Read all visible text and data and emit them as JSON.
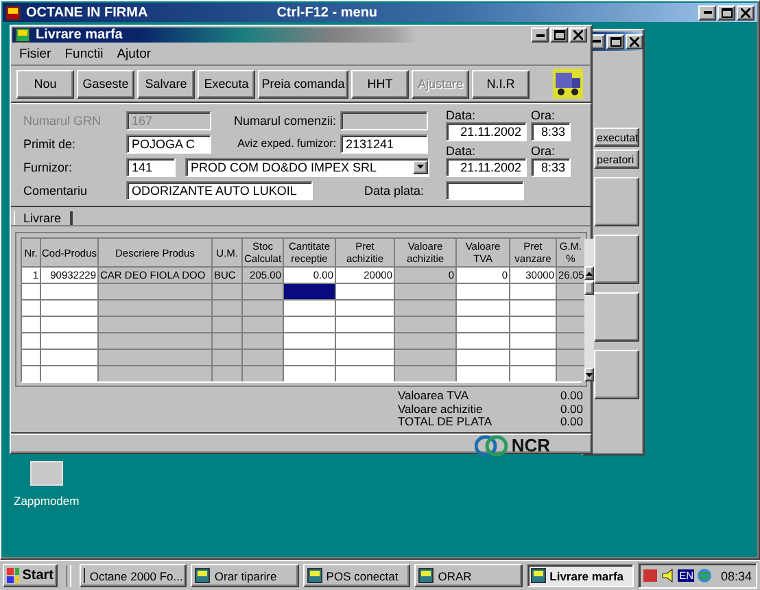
{
  "app_window": {
    "title": "OCTANE IN FIRMA",
    "hint": "Ctrl-F12 - menu"
  },
  "background_window": {
    "buttons": [
      "executat",
      "peratori"
    ]
  },
  "window": {
    "title": "Livrare marfa",
    "menu": [
      "Fisier",
      "Functii",
      "Ajutor"
    ],
    "toolbar": [
      {
        "label": "Nou",
        "disabled": false
      },
      {
        "label": "Gaseste",
        "disabled": false
      },
      {
        "label": "Salvare",
        "disabled": false
      },
      {
        "label": "Executa",
        "disabled": false
      },
      {
        "label": "Preia comanda",
        "disabled": false
      },
      {
        "label": "HHT",
        "disabled": false
      },
      {
        "label": "Ajustare",
        "disabled": true
      },
      {
        "label": "N.I.R",
        "disabled": false
      }
    ],
    "form": {
      "grn": {
        "label": "Numarul GRN",
        "value": "167",
        "disabled": true
      },
      "primit_de": {
        "label": "Primit de:",
        "value": "POJOGA C"
      },
      "furnizor": {
        "label": "Furnizor:",
        "code": "141",
        "name": "PROD COM DO&DO IMPEX SRL"
      },
      "comentariu": {
        "label": "Comentariu",
        "value": "ODORIZANTE AUTO LUKOIL"
      },
      "numarul_comenzii": {
        "label": "Numarul comenzii:",
        "disabled": true
      },
      "aviz": {
        "label": "Aviz exped. fumizor:",
        "value": "2131241"
      },
      "data_plata": {
        "label": "Data plata:"
      },
      "dates": [
        {
          "date_label": "Data:",
          "date": "21.11.2002",
          "time_label": "Ora:",
          "time": "8:33"
        },
        {
          "date_label": "Data:",
          "date": "21.11.2002",
          "time_label": "Ora:",
          "time": "8:33"
        }
      ]
    },
    "tabs": [
      {
        "label": "Livrare",
        "selected": true
      }
    ],
    "table": {
      "columns": [
        {
          "label": "Nr.",
          "kind": "input",
          "focused": false
        },
        {
          "label": "Cod-Produs",
          "kind": "input",
          "focused": false
        },
        {
          "label": "Descriere Produs",
          "kind": "text",
          "focused": false
        },
        {
          "label": "U.M.",
          "kind": "text",
          "focused": false
        },
        {
          "label": "Stoc Calculat",
          "kind": "readonly",
          "focused": false
        },
        {
          "label": "Cantitate receptie",
          "kind": "input",
          "focused": true
        },
        {
          "label": "Pret achizitie",
          "kind": "input",
          "focused": false
        },
        {
          "label": "Valoare achizitie",
          "kind": "readonly",
          "focused": false
        },
        {
          "label": "Valoare TVA",
          "kind": "input",
          "focused": false
        },
        {
          "label": "Pret vanzare",
          "kind": "input",
          "focused": false
        },
        {
          "label": "G.M. %",
          "kind": "readonly",
          "focused": false
        }
      ],
      "rows": [
        {
          "cells": [
            "1",
            "90932229",
            "CAR DEO FIOLA DOO",
            "BUC",
            "205.00",
            "0.00",
            "20000",
            "0",
            "0",
            "30000",
            "26.05"
          ],
          "focused": false
        },
        {
          "cells": [],
          "focused": true
        },
        {
          "cells": [],
          "focused": false
        },
        {
          "cells": [],
          "focused": false
        },
        {
          "cells": [],
          "focused": false
        },
        {
          "cells": [],
          "focused": false
        },
        {
          "cells": [],
          "focused": false
        }
      ]
    },
    "totals": [
      {
        "label": "Valoarea TVA",
        "value": "0.00"
      },
      {
        "label": "Valoare achizitie",
        "value": "0.00"
      },
      {
        "label": "TOTAL DE PLATA",
        "value": "0.00"
      }
    ],
    "footer_logo": "NCR"
  },
  "desktop_icons": [
    {
      "label": "Zappmodem"
    }
  ],
  "taskbar": {
    "start": "Start",
    "items": [
      {
        "label": "Octane 2000 Fo...",
        "selected": false
      },
      {
        "label": "Orar tiparire",
        "selected": false
      },
      {
        "label": "POS conectat",
        "selected": false
      },
      {
        "label": "ORAR",
        "selected": false
      },
      {
        "label": "Livrare marfa",
        "selected": true
      }
    ],
    "tray_language": "EN",
    "time": "08:34"
  }
}
